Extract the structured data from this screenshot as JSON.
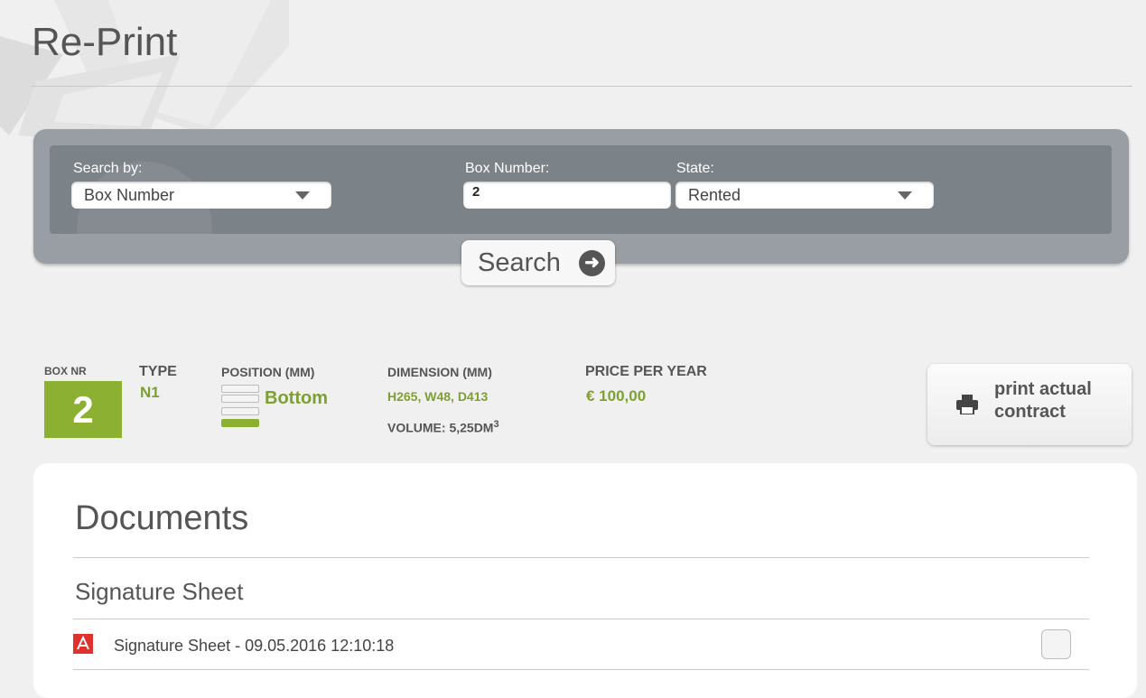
{
  "page": {
    "title": "Re-Print"
  },
  "search": {
    "search_by_label": "Search by:",
    "search_by_value": "Box Number",
    "box_number_label": "Box Number:",
    "box_number_value": "2",
    "state_label": "State:",
    "state_value": "Rented",
    "button_label": "Search"
  },
  "box": {
    "nr_label": "BOX NR",
    "nr_value": "2",
    "type_label": "TYPE",
    "type_value": "N1",
    "position_label": "POSITION (MM)",
    "position_value": "Bottom",
    "position_level": {
      "active_slot": 4,
      "total_slots": 4
    },
    "dimension_label": "DIMENSION (MM)",
    "dimension_value": "H265, W48, D413",
    "volume_text": "VOLUME: 5,25DM",
    "volume_exponent": "3",
    "price_label": "PRICE PER YEAR",
    "price_value": "€ 100,00"
  },
  "actions": {
    "print_contract_label": "print actual contract"
  },
  "documents": {
    "title": "Documents",
    "section_title": "Signature Sheet",
    "items": [
      {
        "label": "Signature Sheet - 09.05.2016 12:10:18",
        "icon": "pdf-icon",
        "checked": false
      }
    ]
  },
  "colors": {
    "accent_green": "#8cb032",
    "panel_gray": "#7b8288",
    "pdf_red": "#e0322c"
  }
}
